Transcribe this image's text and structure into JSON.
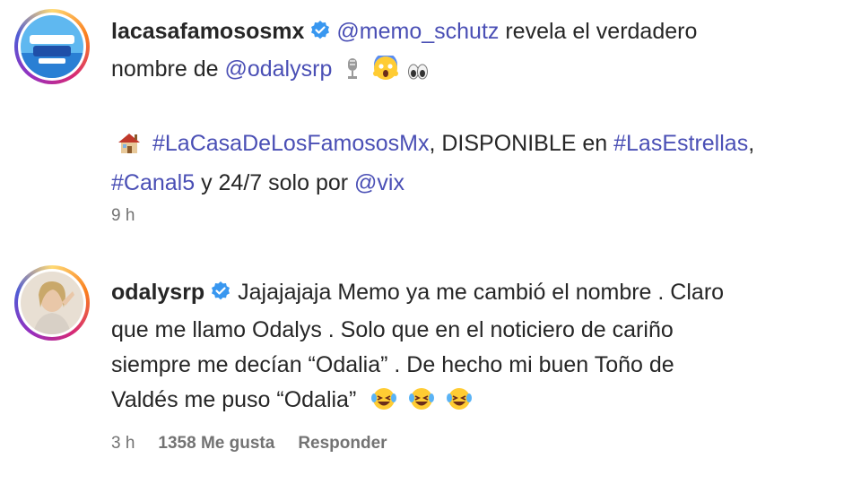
{
  "posts": [
    {
      "username": "lacasafamososmx",
      "lines": [
        {
          "mention": "@memo_schutz",
          "text": " revela el verdadero"
        },
        {
          "text": "nombre de ",
          "mention": "@odalysrp"
        }
      ],
      "line3": {
        "hashtag1": "#LaCasaDeLosFamososMx",
        "text1": ", DISPONIBLE en ",
        "hashtag2": "#LasEstrellas",
        "text2": ","
      },
      "line4": {
        "hashtag": "#Canal5",
        "text": " y 24/7 solo por ",
        "mention": "@vix"
      },
      "time": "9 h",
      "icons": [
        "house-emoji",
        "mic-emoji",
        "scream-emoji",
        "eyes-emoji"
      ]
    },
    {
      "username": "odalysrp",
      "first_line": " Jajajajaja Memo ya me cambió el nombre . Claro",
      "lines": [
        "que me llamo Odalys . Solo que en el noticiero de cariño",
        "siempre me decían “Odalia” . De hecho mi buen Toño de",
        "Valdés me puso “Odalia”"
      ],
      "time": "3 h",
      "likes": "1358 Me gusta",
      "reply": "Responder",
      "icons": [
        "laughing-emoji",
        "laughing-emoji",
        "laughing-emoji"
      ]
    }
  ],
  "colors": {
    "link": "#4a4fb5",
    "verified": "#3897f0",
    "meta": "#737373"
  }
}
